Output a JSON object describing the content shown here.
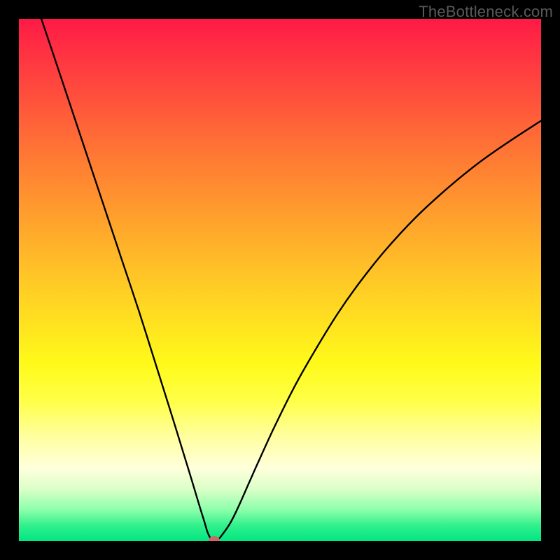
{
  "attribution": "TheBottleneck.com",
  "chart_data": {
    "type": "line",
    "title": "",
    "xlabel": "",
    "ylabel": "",
    "xlim": [
      0,
      100
    ],
    "ylim": [
      0,
      100
    ],
    "x": [
      4.3,
      7,
      10,
      13,
      15,
      17,
      20,
      23,
      26,
      29,
      31,
      33,
      34.5,
      35.5,
      36.2,
      37.0,
      38.0,
      39.0,
      40.5,
      42,
      44,
      46,
      49,
      53,
      57,
      61,
      65,
      70,
      76,
      82,
      88,
      94,
      100
    ],
    "y": [
      100,
      92,
      83,
      74,
      68,
      62,
      53,
      44,
      34.5,
      25,
      18.5,
      12,
      7,
      3.8,
      1.5,
      0.2,
      0.2,
      1.3,
      3.5,
      6.5,
      11,
      15.5,
      22,
      30,
      37,
      43.5,
      49.2,
      55.5,
      62,
      67.5,
      72.4,
      76.6,
      80.5
    ],
    "marker": {
      "x": 37.4,
      "y": 0.2
    },
    "gradient_stops": [
      {
        "pos": 0,
        "color": "#ff1946"
      },
      {
        "pos": 50,
        "color": "#ffc826"
      },
      {
        "pos": 73,
        "color": "#ffff46"
      },
      {
        "pos": 100,
        "color": "#00e682"
      }
    ]
  }
}
